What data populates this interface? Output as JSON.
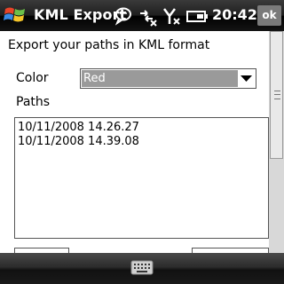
{
  "titlebar": {
    "app_title": "KML Export",
    "clock": "20:42",
    "ok_label": "ok",
    "icons": [
      "windows-start-icon",
      "messaging-icon",
      "connectivity-icon",
      "signal-off-icon",
      "battery-icon"
    ]
  },
  "form": {
    "heading": "Export your paths in KML format",
    "color_label": "Color",
    "color_value": "Red",
    "paths_label": "Paths",
    "paths": [
      "10/11/2008 14.26.27",
      "10/11/2008 14.39.08"
    ]
  },
  "softkeys": {
    "icons": [
      "keyboard-icon"
    ]
  },
  "colors": {
    "titlebar": "#000000",
    "combo_selected": "#9a9a9a",
    "background": "#ffffff"
  }
}
